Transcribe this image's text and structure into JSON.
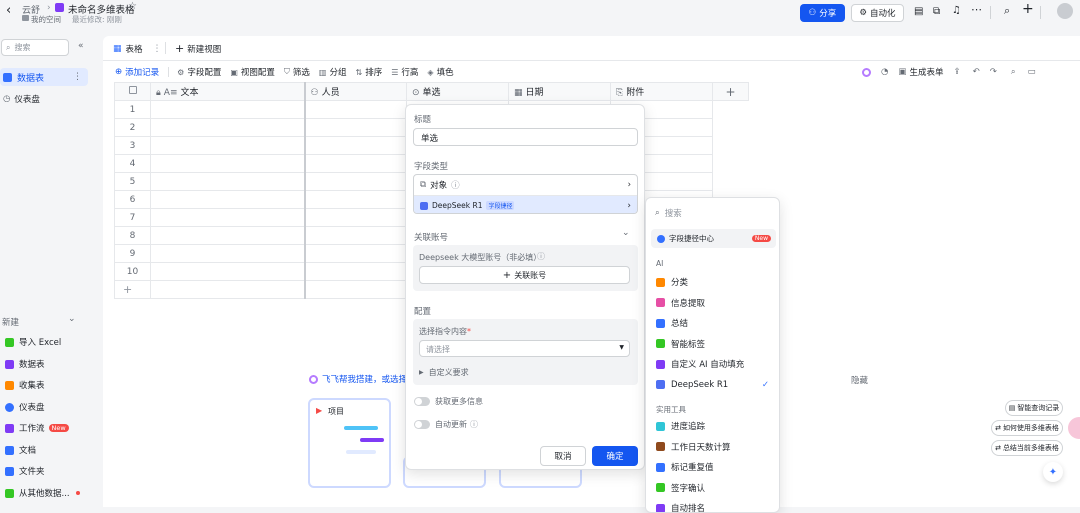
{
  "topbar": {
    "breadcrumb": "云舒",
    "title": "未命名多维表格",
    "location": "我的空间",
    "modified": "最近修改: 刚刚",
    "share_label": "分享",
    "automation_label": "自动化"
  },
  "sidebar": {
    "search_placeholder": "搜索",
    "items": [
      {
        "label": "数据表"
      },
      {
        "label": "仪表盘"
      }
    ],
    "new_label": "新建",
    "new_items": [
      {
        "label": "导入 Excel",
        "color": "#34c724"
      },
      {
        "label": "数据表",
        "color": "#7f3bf5"
      },
      {
        "label": "收集表",
        "color": "#ff8800"
      },
      {
        "label": "仪表盘",
        "color": "#3370ff"
      },
      {
        "label": "工作流",
        "badge": "New",
        "color": "#7f3bf5"
      },
      {
        "label": "文档",
        "color": "#3370ff"
      },
      {
        "label": "文件夹",
        "color": "#3370ff"
      },
      {
        "label": "从其他数据...",
        "color": "#f54a45"
      }
    ]
  },
  "view_tabs": {
    "active": "表格",
    "new_view": "新建视图"
  },
  "toolbar": {
    "add_record": "添加记录",
    "items": [
      "字段配置",
      "视图配置",
      "筛选",
      "分组",
      "排序",
      "行高",
      "填色"
    ],
    "generate_form": "生成表单"
  },
  "grid": {
    "columns": [
      "文本",
      "人员",
      "单选",
      "日期",
      "附件"
    ],
    "rows": [
      "1",
      "2",
      "3",
      "4",
      "5",
      "6",
      "7",
      "8",
      "9",
      "10"
    ]
  },
  "field_panel": {
    "title_label": "标题",
    "title_value": "单选",
    "type_label": "字段类型",
    "type_object": "对象",
    "type_selected": "DeepSeek R1",
    "type_selected_tag": "字段捷径",
    "account_label": "关联账号",
    "account_field": "Deepseek 大模型账号（非必填）",
    "account_button": "关联账号",
    "config_label": "配置",
    "instruction_label": "选择指令内容",
    "instruction_placeholder": "请选择",
    "custom_label": "自定义要求",
    "more_info": "获取更多信息",
    "auto_update": "自动更新",
    "cancel": "取消",
    "confirm": "确定"
  },
  "shortcut_menu": {
    "search_placeholder": "搜索",
    "center_label": "字段捷径中心",
    "center_badge": "New",
    "ai_section": "AI",
    "ai_items": [
      {
        "label": "分类",
        "color": "#ff8800"
      },
      {
        "label": "信息提取",
        "color": "#e64fa5"
      },
      {
        "label": "总结",
        "color": "#3370ff"
      },
      {
        "label": "智能标签",
        "color": "#34c724"
      },
      {
        "label": "自定义 AI 自动填充",
        "color": "#7f3bf5"
      },
      {
        "label": "DeepSeek R1",
        "color": "#4e6ef2",
        "checked": true
      }
    ],
    "tools_section": "实用工具",
    "tool_items": [
      {
        "label": "进度追踪",
        "color": "#2fc5d6"
      },
      {
        "label": "工作日天数计算",
        "color": "#8f4a1d"
      },
      {
        "label": "标记重复值",
        "color": "#3370ff"
      },
      {
        "label": "签字确认",
        "color": "#34c724"
      },
      {
        "label": "自动排名",
        "color": "#7f3bf5"
      }
    ]
  },
  "background": {
    "helper_text": "飞飞帮我搭建，或选择",
    "hide_label": "隐藏",
    "card_title": "项目"
  },
  "right_tips": [
    "智能查询记录",
    "如何使用多维表格",
    "总结当前多维表格"
  ]
}
